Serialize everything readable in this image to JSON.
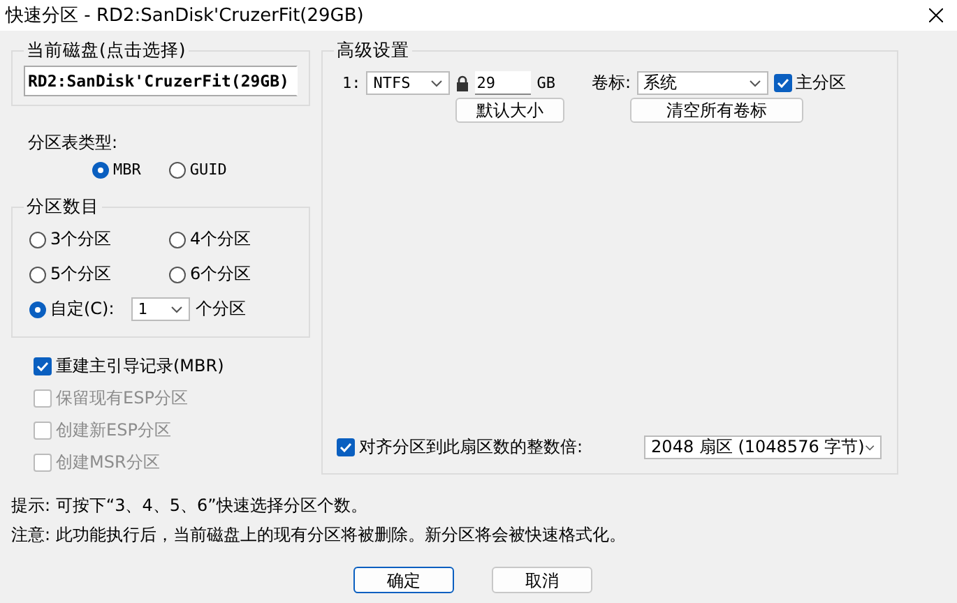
{
  "window": {
    "title": "快速分区 - RD2:SanDisk'CruzerFit(29GB)"
  },
  "disk_group": {
    "title": "当前磁盘(点击选择)",
    "value": "RD2:SanDisk'CruzerFit(29GB)"
  },
  "partition_table": {
    "label": "分区表类型:",
    "options": [
      {
        "label": "MBR",
        "selected": true
      },
      {
        "label": "GUID",
        "selected": false
      }
    ]
  },
  "count_group": {
    "title": "分区数目",
    "options": [
      {
        "kind": "preset",
        "label": "3个分区",
        "selected": false
      },
      {
        "kind": "preset",
        "label": "4个分区",
        "selected": false
      },
      {
        "kind": "preset",
        "label": "5个分区",
        "selected": false
      },
      {
        "kind": "preset",
        "label": "6个分区",
        "selected": false
      },
      {
        "kind": "custom",
        "label": "自定(C):",
        "selected": true,
        "value": "1",
        "suffix": "个分区"
      }
    ]
  },
  "checkboxes": [
    {
      "label": "重建主引导记录(MBR)",
      "checked": true,
      "disabled": false
    },
    {
      "label": "保留现有ESP分区",
      "checked": false,
      "disabled": true
    },
    {
      "label": "创建新ESP分区",
      "checked": false,
      "disabled": true
    },
    {
      "label": "创建MSR分区",
      "checked": false,
      "disabled": true
    }
  ],
  "advanced": {
    "title": "高级设置",
    "rows": [
      {
        "index": "1:",
        "filesystem": "NTFS",
        "size": "29",
        "unit": "GB",
        "label_caption": "卷标:",
        "volume_label": "系统",
        "primary": {
          "label": "主分区",
          "checked": true
        }
      }
    ],
    "buttons": [
      "默认大小",
      "清空所有卷标"
    ],
    "align": {
      "label": "对齐分区到此扇区数的整数倍:",
      "checked": true,
      "value": "2048 扇区 (1048576 字节)"
    }
  },
  "notes": [
    "提示: 可按下“3、4、5、6”快速选择分区个数。",
    "注意: 此功能执行后，当前磁盘上的现有分区将被删除。新分区将会被快速格式化。"
  ],
  "buttons": [
    {
      "label": "确定",
      "default": true
    },
    {
      "label": "取消",
      "default": false
    }
  ]
}
